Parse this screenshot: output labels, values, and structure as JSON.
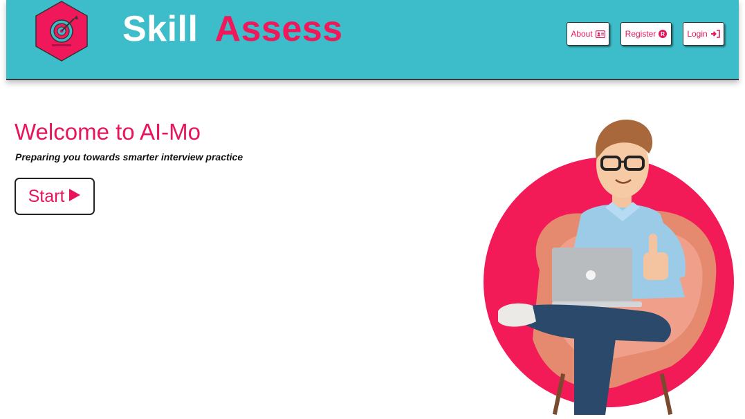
{
  "header": {
    "brand_part1": "Skill",
    "brand_part2": "Assess",
    "logo_icon": "target-dart-icon",
    "nav": {
      "about_label": "About",
      "about_icon": "id-card-icon",
      "register_label": "Register",
      "register_icon": "registered-icon",
      "login_label": "Login",
      "login_icon": "sign-in-icon"
    }
  },
  "hero": {
    "title": "Welcome to AI-Mo",
    "tagline": "Preparing you towards smarter interview practice",
    "start_label": "Start",
    "start_icon": "play-icon",
    "illustration": "man-with-laptop-in-armchair-thumbs-up"
  },
  "colors": {
    "header_bg": "#3dbdc9",
    "accent": "#f0185a",
    "brand_white": "#ffffff"
  }
}
